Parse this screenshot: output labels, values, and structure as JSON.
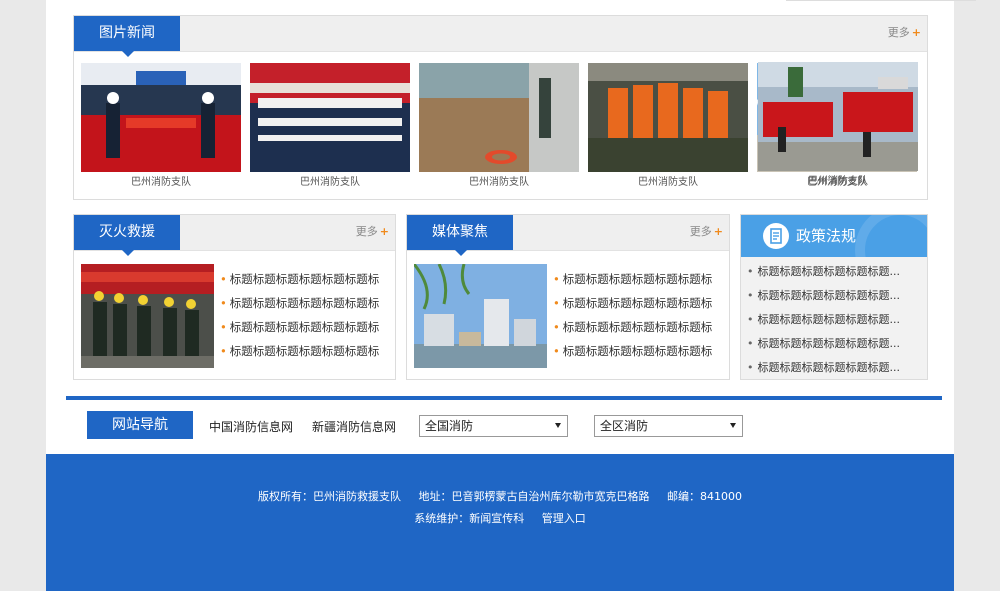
{
  "photo_news": {
    "title": "图片新闻",
    "more": "更多",
    "items": [
      {
        "caption": "巴州消防支队"
      },
      {
        "caption": "巴州消防支队"
      },
      {
        "caption": "巴州消防支队"
      },
      {
        "caption": "巴州消防支队"
      },
      {
        "caption": "巴州消防支队"
      }
    ]
  },
  "rescue": {
    "title": "灭火救援",
    "more": "更多",
    "items": [
      "标题标题标题标题标题标题标",
      "标题标题标题标题标题标题标",
      "标题标题标题标题标题标题标",
      "标题标题标题标题标题标题标"
    ]
  },
  "media": {
    "title": "媒体聚焦",
    "more": "更多",
    "items": [
      "标题标题标题标题标题标题标",
      "标题标题标题标题标题标题标",
      "标题标题标题标题标题标题标",
      "标题标题标题标题标题标题标"
    ]
  },
  "policy": {
    "title": "政策法规",
    "items": [
      "标题标题标题标题标题标题...",
      "标题标题标题标题标题标题...",
      "标题标题标题标题标题标题...",
      "标题标题标题标题标题标题...",
      "标题标题标题标题标题标题..."
    ]
  },
  "site_nav": {
    "title": "网站导航",
    "link1": "中国消防信息网",
    "link2": "新疆消防信息网",
    "select1": "全国消防",
    "select2": "全区消防"
  },
  "footer": {
    "copyright": "版权所有：巴州消防救援支队",
    "address": "地址：巴音郭楞蒙古自治州库尔勒市宽克巴格路",
    "postcode": "邮编：841000",
    "maintain": "系统维护：新闻宣传科",
    "admin": "管理入口"
  },
  "colors": {
    "primary": "#1f66c5",
    "accent": "#f08a1c",
    "policy_head": "#4aa0e6"
  }
}
